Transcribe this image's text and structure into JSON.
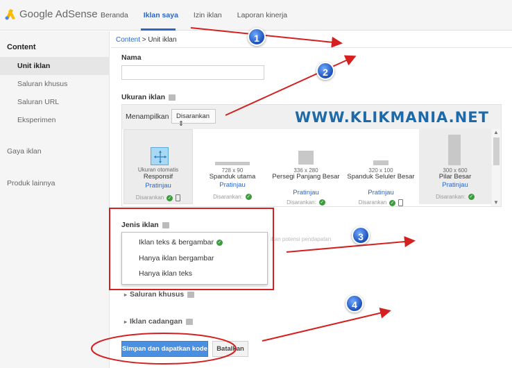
{
  "brand": {
    "logo_text": "Google AdSense"
  },
  "nav": {
    "items": [
      "Beranda",
      "Iklan saya",
      "Izin iklan",
      "Laporan kinerja"
    ]
  },
  "sidebar": {
    "heading": "Content",
    "items": [
      "Unit iklan",
      "Saluran khusus",
      "Saluran URL",
      "Eksperimen"
    ],
    "extra": [
      "Gaya iklan",
      "Produk lainnya"
    ]
  },
  "breadcrumb": {
    "link": "Content",
    "current": " > Unit iklan"
  },
  "form": {
    "name_label": "Nama",
    "size_label": "Ukuran iklan",
    "show_label": "Menampilkan",
    "show_value": "Disarankan",
    "watermark": "WWW.KLIKMANIA.NET",
    "cards": [
      {
        "dim": "Ukuran otomatis",
        "name": "Responsif",
        "preview": "Pratinjau",
        "recommended": "Disarankan"
      },
      {
        "dim": "728 x 90",
        "name": "Spanduk utama",
        "preview": "Pratinjau",
        "recommended": "Disarankan:"
      },
      {
        "dim": "336 x 280",
        "name": "Persegi Panjang Besar",
        "preview": "Pratinjau",
        "recommended": "Disarankan:"
      },
      {
        "dim": "320 x 100",
        "name": "Spanduk Seluler Besar",
        "preview": "Pratinjau",
        "recommended": "Disarankan"
      },
      {
        "dim": "300 x 600",
        "name": "Pilar Besar",
        "preview": "Pratinjau",
        "recommended": "Disarankan:"
      }
    ],
    "type_label": "Jenis iklan",
    "type_options": [
      "Iklan teks & bergambar",
      "Hanya iklan bergambar",
      "Hanya iklan teks"
    ],
    "faded_note": "ikan potensi pendapatan",
    "custom_channels": "Saluran khusus",
    "backup_ads": "Iklan cadangan",
    "save_label": "Simpan dan dapatkan kode",
    "cancel_label": "Batalkan"
  },
  "annotations": {
    "badges": [
      "1",
      "2",
      "3",
      "4"
    ]
  },
  "colors": {
    "accent": "#2a66c9",
    "annotation": "#d42020",
    "button": "#4a90e2"
  }
}
